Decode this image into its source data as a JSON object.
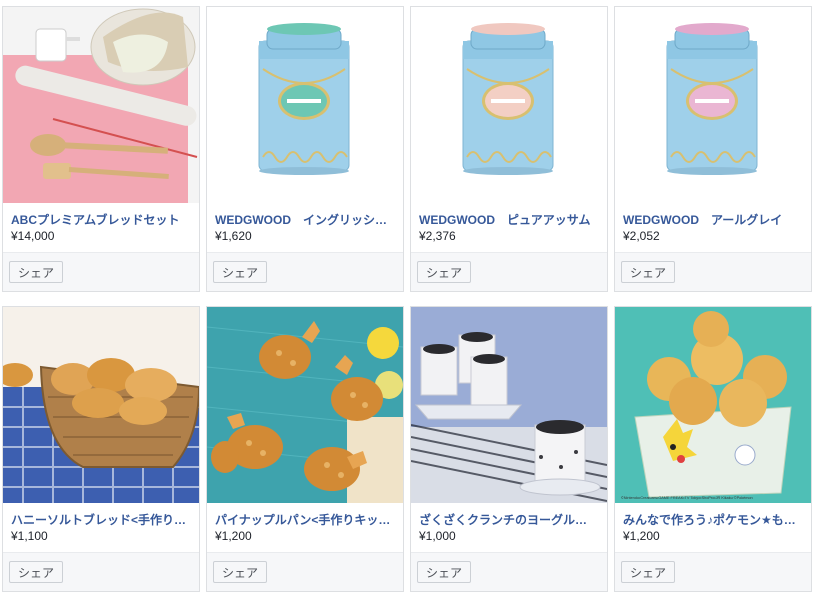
{
  "products": [
    {
      "title": "ABCプレミアムブレッドセット",
      "price": "¥14,000",
      "share_label": "シェア",
      "image": "bread-kit-tools"
    },
    {
      "title": "WEDGWOOD　イングリッシュブレックファスト",
      "price": "¥1,620",
      "share_label": "シェア",
      "image": "wedgwood-tea-tin-mint"
    },
    {
      "title": "WEDGWOOD　ピュアアッサム",
      "price": "¥2,376",
      "share_label": "シェア",
      "image": "wedgwood-tea-tin-peach"
    },
    {
      "title": "WEDGWOOD　アールグレイ",
      "price": "¥2,052",
      "share_label": "シェア",
      "image": "wedgwood-tea-tin-pink"
    },
    {
      "title": "ハニーソルトブレッド<手作りキット>",
      "price": "¥1,100",
      "share_label": "シェア",
      "image": "bread-basket"
    },
    {
      "title": "パイナップルパン<手作りキット>",
      "price": "¥1,200",
      "share_label": "シェア",
      "image": "pineapple-buns"
    },
    {
      "title": "ざくざくクランチのヨーグルトムース",
      "price": "¥1,000",
      "share_label": "シェア",
      "image": "cookie-mousse"
    },
    {
      "title": "みんなで作ろう♪ポケモン★もちもちボール",
      "price": "¥1,200",
      "share_label": "シェア",
      "image": "pokemon-puffs",
      "image_credit": "©Nintendo•Creatures•GAME FREAK•TV Tokyo•ShoPro•JR Kikaku ©Pokémon"
    }
  ],
  "colors": {
    "title": "#365899",
    "border": "#dddfe2",
    "footer": "#f6f7f9"
  }
}
